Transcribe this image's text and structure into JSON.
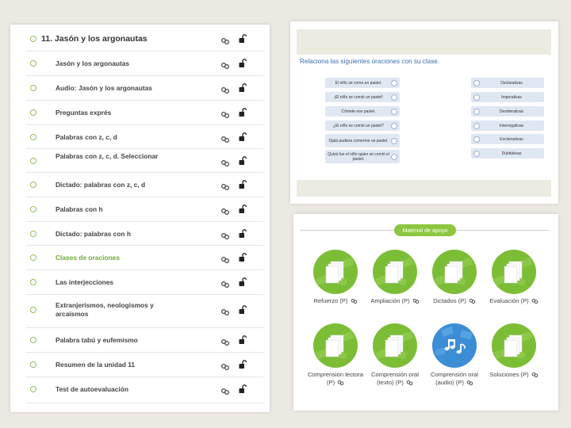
{
  "unit_list": {
    "header": "11. Jasón y los argonautas",
    "items": [
      {
        "label": "Jasón y los argonautas",
        "active": false
      },
      {
        "label": "Audio: Jasón y los argonautas",
        "active": false
      },
      {
        "label": "Preguntas exprés",
        "active": false
      },
      {
        "label": "Palabras con z, c, d",
        "active": false
      },
      {
        "label": "Palabras con z, c, d. Seleccionar",
        "active": false
      },
      {
        "label": "Dictado: palabras con z, c, d",
        "active": false
      },
      {
        "label": "Palabras con h",
        "active": false
      },
      {
        "label": "Dictado: palabras con h",
        "active": false
      },
      {
        "label": "Clases de oraciones",
        "active": true
      },
      {
        "label": "Las interjecciones",
        "active": false
      },
      {
        "label": "Extranjerismos, neologismos y arcaísmos",
        "active": false
      },
      {
        "label": "Palabra tabú y eufemismo",
        "active": false
      },
      {
        "label": "Resumen de la unidad 11",
        "active": false
      },
      {
        "label": "Test de autoevaluación",
        "active": false
      }
    ]
  },
  "exercise": {
    "instruction": "Relaciona las siguientes oraciones con su clase.",
    "sentences": [
      "El niño se come un pastel.",
      "¡El niño se comió un pastel!",
      "Cómete ese pastel.",
      "¿El niño se comió un pastel?",
      "Ojalá pudiera comerme un pastel.",
      "Quizá fue el niño quien se comió el pastel."
    ],
    "categories": [
      "Declarativas",
      "Imperativas",
      "Desiderativas",
      "Interrogativas",
      "Exclamativas",
      "Dubitativas"
    ]
  },
  "material": {
    "header": "Material de apoyo",
    "resources": [
      {
        "label": "Refuerzo (P)",
        "type": "doc"
      },
      {
        "label": "Ampliación (P)",
        "type": "doc"
      },
      {
        "label": "Dictados (P)",
        "type": "doc"
      },
      {
        "label": "Evaluación (P)",
        "type": "doc"
      },
      {
        "label": "Comprensión lectora (P)",
        "type": "doc"
      },
      {
        "label": "Comprensión oral (texto) (P)",
        "type": "doc"
      },
      {
        "label": "Comprensión oral (audio) (P)",
        "type": "audio"
      },
      {
        "label": "Soluciones (P)",
        "type": "doc"
      }
    ]
  },
  "colors": {
    "accent_green": "#8dc63f",
    "active_text": "#6cad32",
    "instruction_blue": "#3d6fae",
    "audio_blue": "#3b8dd6"
  },
  "icons": {
    "row_link": "link-icon",
    "row_lock": "unlock-icon",
    "doc_resource": "document-stack-icon",
    "audio_resource": "music-notes-icon"
  }
}
